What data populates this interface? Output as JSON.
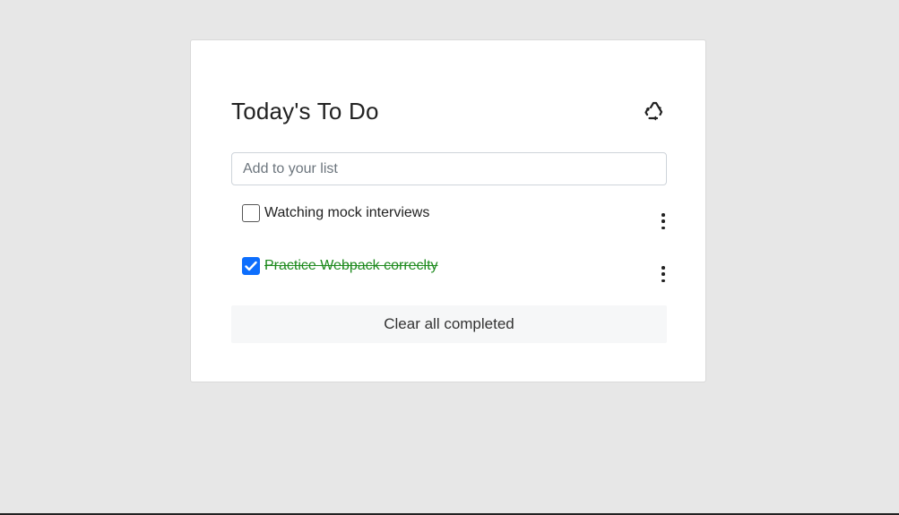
{
  "card": {
    "title": "Today's To Do",
    "refresh_icon": "recycle-icon"
  },
  "input": {
    "placeholder": "Add to your list",
    "value": ""
  },
  "tasks": [
    {
      "label": "Watching mock interviews",
      "completed": false,
      "menu_icon": "more-vertical-icon"
    },
    {
      "label": "Practice Webpack correclty",
      "completed": true,
      "menu_icon": "more-vertical-icon"
    }
  ],
  "clear_button": {
    "label": "Clear all completed"
  },
  "colors": {
    "background": "#e7e7e7",
    "card": "#ffffff",
    "checkbox_checked": "#0d6efd",
    "completed_text": "#1e8a1e",
    "clear_button_bg": "#f6f7f8"
  }
}
